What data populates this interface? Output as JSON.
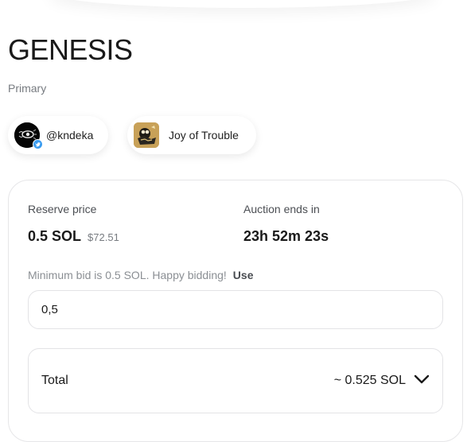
{
  "artwork": {
    "title": "GENESIS",
    "subtitle": "Primary"
  },
  "creator": {
    "handle": "@kndeka",
    "avatar_icon": "eye-avatar-icon",
    "verified_icon": "twitter-verified-icon"
  },
  "collection": {
    "name": "Joy of Trouble",
    "thumb_icon": "collection-artwork-thumbnail"
  },
  "auction": {
    "reserve_label": "Reserve price",
    "reserve_sol": "0.5 SOL",
    "reserve_usd": "$72.51",
    "ends_label": "Auction ends in",
    "countdown": "23h 52m 23s",
    "min_bid_text": "Minimum bid is 0.5 SOL. Happy bidding!",
    "use_label": "Use",
    "bid_value": "0,5",
    "total_label": "Total",
    "total_value": "~ 0.525 SOL",
    "expand_icon": "chevron-down-icon"
  },
  "colors": {
    "text": "#1a1a1a",
    "muted": "#777b80",
    "border": "#e3e3e6",
    "verified": "#3b9cf0"
  }
}
